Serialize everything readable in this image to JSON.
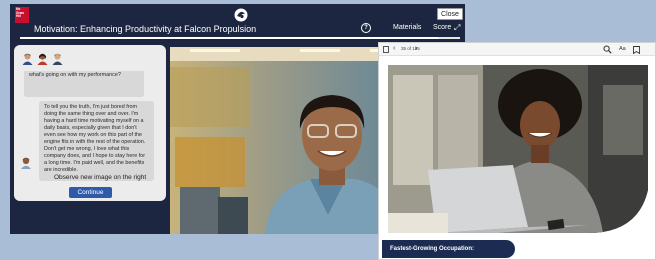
{
  "header": {
    "logo_text": "Mc Graw Hill",
    "title": "Motivation: Enhancing Productivity at Falcon Propulsion",
    "materials_label": "Materials",
    "score_label": "Score",
    "close_label": "Close",
    "progress": 0.95,
    "icons": [
      "help-icon",
      "expand-icon",
      "brand-icon"
    ]
  },
  "dialogue": {
    "messages": [
      {
        "speaker": "manager",
        "text": "to talk to me. I understand you want to know what's going on with my performance?"
      },
      {
        "speaker": "employee",
        "text": "To tell you the truth, I'm just bored from doing the same thing over and over. I'm having a hard time motivating myself on a daily basis, especially given that I don't even see how my work on this part of the engine fits in with the rest of the operation. Don't get me wrong, I love what this company does, and I hope to stay here for a long time. I'm paid well, and the benefits are incredible."
      }
    ],
    "instruction": "Observe new image on the right",
    "continue_label": "Continue"
  },
  "reader": {
    "page_indicator": "35 of 185",
    "font_size_label": "Aa",
    "section_heading": "Fastest-Growing Occupation:"
  },
  "colors": {
    "header_bg": "#1d2640",
    "accent_button": "#2e5aa8",
    "section_heading_bg": "#1c2b52",
    "page_bg": "#a9bdd6"
  }
}
